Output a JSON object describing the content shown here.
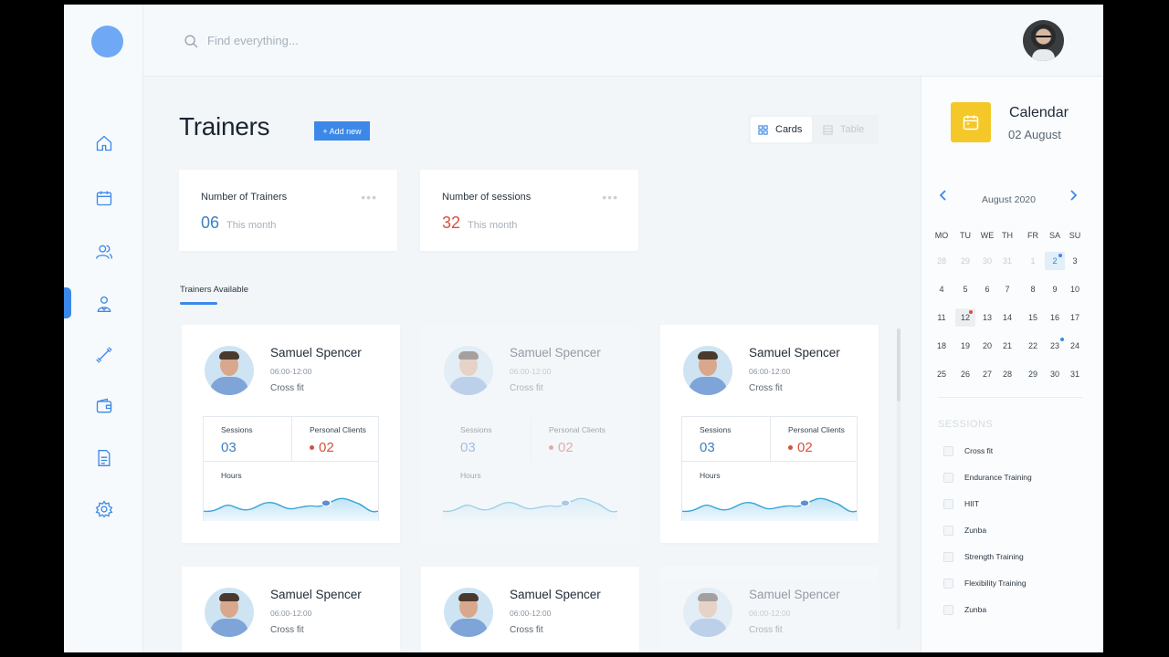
{
  "search": {
    "placeholder": "Find everything..."
  },
  "page": {
    "title": "Trainers",
    "add_label": "+ Add new"
  },
  "view_toggle": {
    "cards_label": "Cards",
    "table_label": "Table",
    "active": "Cards"
  },
  "stats": [
    {
      "label": "Number of Trainers",
      "value": "06",
      "sub": "This month",
      "color": "#3b7fc4"
    },
    {
      "label": "Number of sessions",
      "value": "32",
      "sub": "This month",
      "color": "#d4513f"
    }
  ],
  "section": {
    "label": "Trainers Available"
  },
  "trainer_card": {
    "sessions_label": "Sessions",
    "clients_label": "Personal Clients",
    "hours_label": "Hours"
  },
  "trainers": [
    {
      "name": "Samuel Spencer",
      "time": "06:00-12:00",
      "type": "Cross fit",
      "sessions": "03",
      "clients": "02",
      "faded": false
    },
    {
      "name": "Samuel Spencer",
      "time": "06:00-12:00",
      "type": "Cross fit",
      "sessions": "03",
      "clients": "02",
      "faded": true
    },
    {
      "name": "Samuel Spencer",
      "time": "06:00-12:00",
      "type": "Cross fit",
      "sessions": "03",
      "clients": "02",
      "faded": false
    },
    {
      "name": "Samuel Spencer",
      "time": "06:00-12:00",
      "type": "Cross fit",
      "faded": false
    },
    {
      "name": "Samuel Spencer",
      "time": "06:00-12:00",
      "type": "Cross fit",
      "faded": false
    },
    {
      "name": "Samuel Spencer",
      "time": "06:00-12:00",
      "type": "Cross fit",
      "faded": true
    }
  ],
  "calendar": {
    "title": "Calendar",
    "date": "02 August",
    "month": "August 2020",
    "weekdays": [
      "MO",
      "TU",
      "WE",
      "TH",
      "FR",
      "SA",
      "SU"
    ],
    "weeks": [
      [
        "28",
        "29",
        "30",
        "31",
        "1",
        "2",
        "3"
      ],
      [
        "4",
        "5",
        "6",
        "7",
        "8",
        "9",
        "10"
      ],
      [
        "11",
        "12",
        "13",
        "14",
        "15",
        "16",
        "17"
      ],
      [
        "18",
        "19",
        "20",
        "21",
        "22",
        "23",
        "24"
      ],
      [
        "25",
        "26",
        "27",
        "28",
        "29",
        "30",
        "31"
      ]
    ],
    "muted_first_week": 5,
    "selected": "2",
    "highlighted": "12"
  },
  "sessions": {
    "label": "SESSIONS",
    "items": [
      "Cross fit",
      "Endurance Training",
      "HIIT",
      "Zunba",
      "Strength Training",
      "Flexibility Training",
      "Zunba"
    ]
  },
  "icons": {
    "nav": [
      "home-icon",
      "calendar-icon",
      "users-icon",
      "trainer-icon",
      "dumbbell-icon",
      "wallet-icon",
      "document-icon",
      "settings-icon"
    ],
    "active_nav": "trainer-icon"
  },
  "colors": {
    "accent": "#3b88e8",
    "calendar_badge": "#f4c828",
    "sessions_value": "#3b7fc4",
    "clients_value": "#d4513f"
  }
}
